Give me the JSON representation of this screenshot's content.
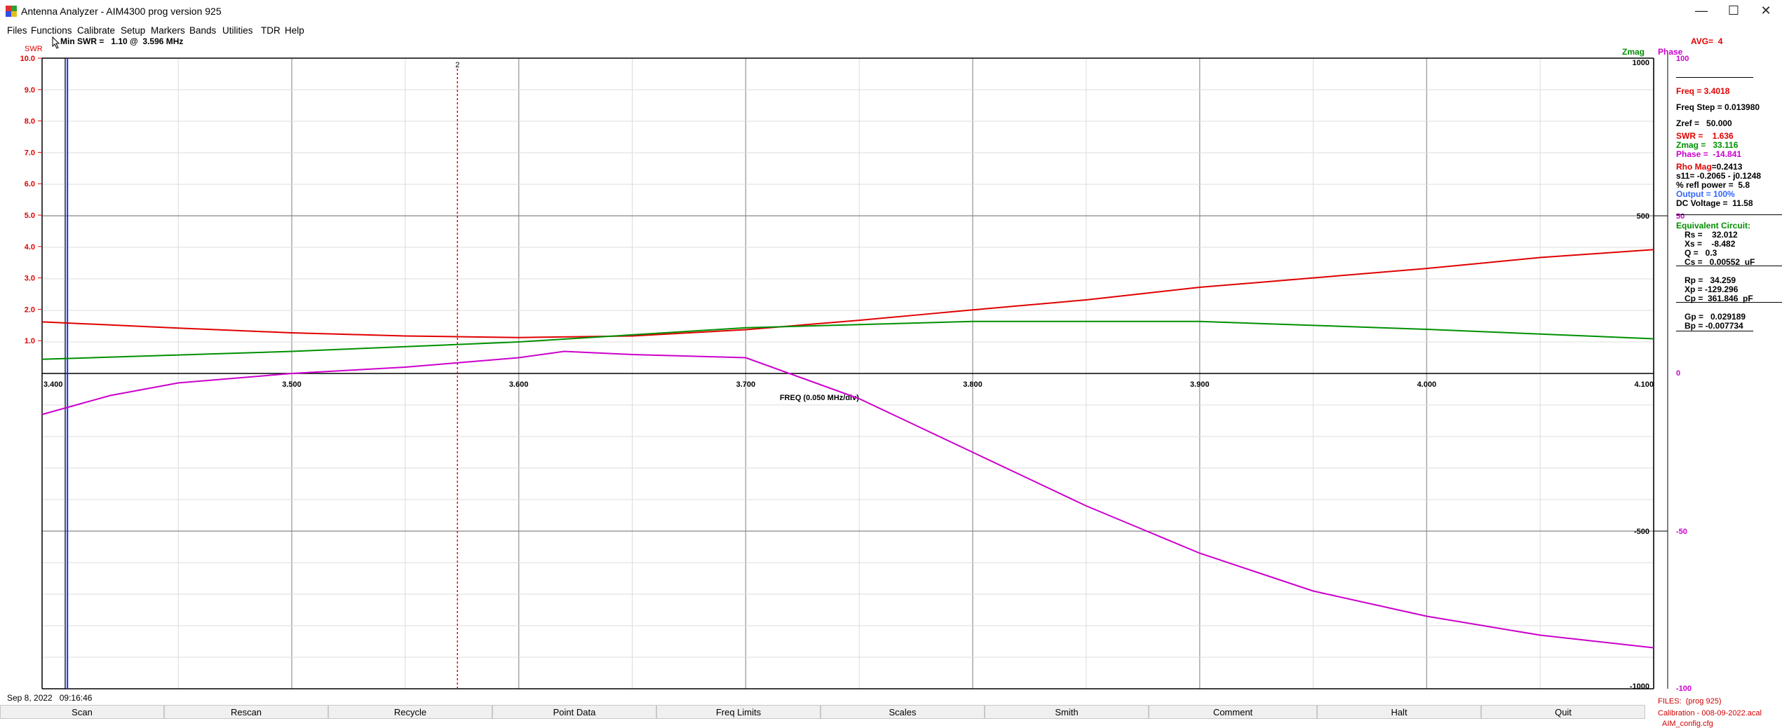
{
  "window": {
    "title": "Antenna Analyzer - AIM4300     prog version 925",
    "minimize_glyph": "—",
    "maximize_glyph": "☐",
    "close_glyph": "✕"
  },
  "menu": [
    "Files",
    "Functions",
    "Calibrate",
    "Setup",
    "Markers",
    "Bands",
    "Utilities",
    "TDR",
    "Help"
  ],
  "header": {
    "swr_label": "SWR",
    "min_swr": "Min SWR =   1.10 @  3.596 MHz",
    "zmag_label": "Zmag",
    "phase_label": "Phase",
    "avg": "AVG=  4"
  },
  "colors": {
    "swr": "#e00000",
    "zmag": "#009000",
    "phase": "#cc00cc",
    "output": "#3366ff",
    "grid": "#c0c0c0"
  },
  "chart_data": {
    "type": "line",
    "xlabel": "FREQ (0.050 MHz/div)",
    "xlim": [
      3.39,
      4.1
    ],
    "x_ticks": [
      "3.400",
      "3.500",
      "3.600",
      "3.700",
      "3.800",
      "3.900",
      "4.000",
      "4.100"
    ],
    "swr_axis": {
      "ticks": [
        "10.0",
        "9.0",
        "8.0",
        "7.0",
        "6.0",
        "5.0",
        "4.0",
        "3.0",
        "2.0",
        "1.0"
      ],
      "ylim": [
        0,
        10
      ]
    },
    "zmag_axis": {
      "ticks": [
        "1000",
        "500",
        "-500",
        "-1000"
      ],
      "ylim": [
        -1000,
        1000
      ]
    },
    "phase_axis": {
      "ticks": [
        "100",
        "50",
        "0",
        "-50",
        "-100"
      ],
      "ylim": [
        -100,
        100
      ]
    },
    "marker": {
      "label": "2",
      "x": 3.573
    },
    "series": [
      {
        "name": "SWR",
        "x": [
          3.39,
          3.45,
          3.5,
          3.55,
          3.6,
          3.65,
          3.7,
          3.75,
          3.8,
          3.85,
          3.9,
          3.95,
          4.0,
          4.05,
          4.1
        ],
        "values": [
          1.6,
          1.4,
          1.25,
          1.15,
          1.1,
          1.15,
          1.35,
          1.65,
          1.98,
          2.3,
          2.7,
          3.0,
          3.3,
          3.65,
          3.9
        ]
      },
      {
        "name": "Zmag",
        "x": [
          3.39,
          3.5,
          3.6,
          3.7,
          3.8,
          3.9,
          4.0,
          4.1
        ],
        "values": [
          45,
          70,
          100,
          145,
          165,
          165,
          140,
          110
        ]
      },
      {
        "name": "Phase",
        "x": [
          3.39,
          3.42,
          3.45,
          3.5,
          3.55,
          3.6,
          3.62,
          3.65,
          3.7,
          3.75,
          3.8,
          3.85,
          3.9,
          3.95,
          4.0,
          4.05,
          4.1
        ],
        "values": [
          -13,
          -7,
          -3,
          0,
          2,
          5,
          7,
          6,
          5,
          -8,
          -25,
          -42,
          -57,
          -69,
          -77,
          -83,
          -87
        ]
      }
    ]
  },
  "readout": {
    "freq": "Freq = 3.4018",
    "freq_step": "Freq Step = 0.013980",
    "zref": "Zref =   50.000",
    "swr": "SWR =    1.636",
    "zmag": "Zmag =   33.116",
    "phase": "Phase =  -14.841",
    "rho_mag_label": "Rho Mag",
    "rho_mag_value": "=0.2413",
    "s11": "s11= -0.2065 - j0.1248",
    "refl_power": "% refl power =  5.8",
    "output_label": "Output =",
    "output_value": "100%",
    "dc_voltage": "DC Voltage =  11.58",
    "equiv_title": "Equivalent Circuit:",
    "rs": "Rs =    32.012",
    "xs": "Xs =    -8.482",
    "q": "Q =   0.3",
    "cs": "Cs =   0.00552  uF",
    "rp": "Rp =   34.259",
    "xp": "Xp = -129.296",
    "cp": "Cp =  361.846  pF",
    "gp": "Gp =   0.029189",
    "bp": "Bp = -0.007734"
  },
  "status": {
    "timestamp": "Sep 8, 2022   09:16:46",
    "files_line": "FILES:  (prog 925)",
    "calibration_line": "Calibration - 008-09-2022.acal",
    "config_line": "AIM_config.cfg"
  },
  "buttons": [
    "Scan",
    "Rescan",
    "Recycle",
    "Point Data",
    "Freq Limits",
    "Scales",
    "Smith",
    "Comment",
    "Halt",
    "Quit"
  ]
}
